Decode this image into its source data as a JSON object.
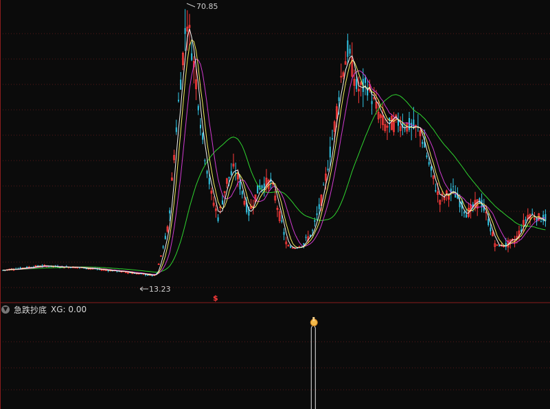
{
  "chart_data": [
    {
      "type": "candlestick",
      "annotations": {
        "high_label": "70.85",
        "low_label": "13.23"
      },
      "signal_marker": "$",
      "y_range": [
        9.5,
        72.5
      ],
      "ma_colors": {
        "ma5": "#f2f2f2",
        "ma10": "#f5f060",
        "ma20": "#d23bd2",
        "ma60": "#2fd52f"
      },
      "up_color": "#ff3b3b",
      "down_color": "#33c8e8"
    },
    {
      "type": "line",
      "indicator_name": "急跌抄底",
      "value_label": "XG: 0.00",
      "signal_index": 0.57
    }
  ]
}
